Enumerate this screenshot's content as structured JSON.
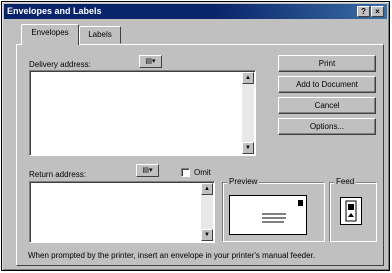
{
  "window": {
    "title": "Envelopes and Labels",
    "help_glyph": "?",
    "close_glyph": "×"
  },
  "tabs": [
    {
      "label": "Envelopes",
      "active": true
    },
    {
      "label": "Labels",
      "active": false
    }
  ],
  "delivery": {
    "label": "Delivery address:",
    "value": ""
  },
  "return": {
    "label": "Return address:",
    "value": "",
    "omit_label": "Omit",
    "omit_checked": false
  },
  "buttons": {
    "print": "Print",
    "add_to_document": "Add to Document",
    "cancel": "Cancel",
    "options": "Options..."
  },
  "preview": {
    "label": "Preview"
  },
  "feed": {
    "label": "Feed"
  },
  "status": "When prompted by the printer, insert an envelope in your printer's manual feeder.",
  "scroll": {
    "up_glyph": "▲",
    "down_glyph": "▼"
  },
  "address_book_glyph": "▤▾"
}
